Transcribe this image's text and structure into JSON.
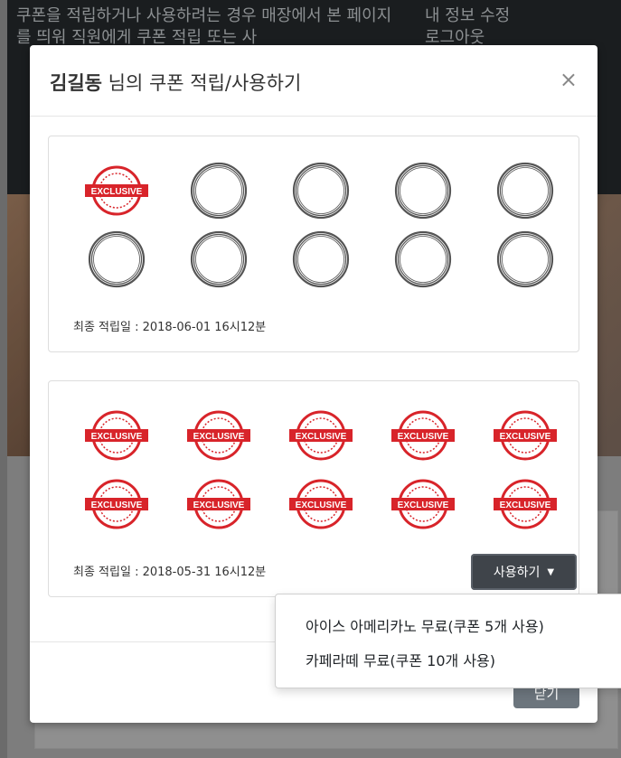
{
  "background": {
    "left_text": "쿠폰을 적립하거나 사용하려는 경우 매장에서 본 페이지를 띄워 직원에게 쿠폰 적립 또는 사",
    "right_links": [
      "내 정보 수정",
      "로그아웃"
    ]
  },
  "modal": {
    "title_name": "김길동",
    "title_rest": " 님의 쿠폰 적립/사용하기",
    "close_glyph": "×",
    "footer_close_label": "닫기"
  },
  "cards": [
    {
      "stamped": 1,
      "total": 10,
      "date": "최종 적립일 : 2018-06-01 16시12분",
      "stamp_text": "EXCLUSIVE"
    },
    {
      "stamped": 10,
      "total": 10,
      "date": "최종 적립일 : 2018-05-31 16시12분",
      "stamp_text": "EXCLUSIVE",
      "use_button": "사용하기"
    }
  ],
  "dropdown": {
    "items": [
      "아이스 아메리카노 무료(쿠폰 5개 사용)",
      "카페라떼 무료(쿠폰 10개 사용)"
    ]
  },
  "colors": {
    "stamp_red": "#d8242a",
    "stamp_empty": "#555555",
    "button_dark": "#3f444a"
  }
}
